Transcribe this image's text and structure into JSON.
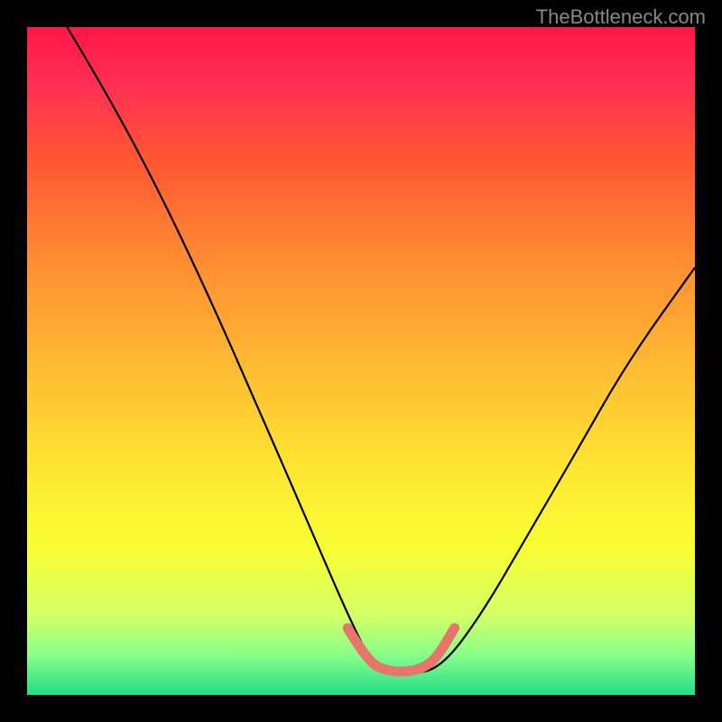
{
  "watermark": "TheBottleneck.com",
  "chart_data": {
    "type": "line",
    "title": "",
    "xlabel": "",
    "ylabel": "",
    "x_range": [
      0,
      100
    ],
    "y_range": [
      0,
      100
    ],
    "gradient_background": {
      "top_color": "#ff1744",
      "bottom_color": "#22dd88",
      "description": "red-to-green vertical gradient (bottleneck severity scale)"
    },
    "series": [
      {
        "name": "bottleneck-curve",
        "description": "V-shaped curve; left branch descends from top-left to a flat trough near x≈52-62 at y≈3, right branch ascends to upper-right",
        "points": [
          {
            "x": 6,
            "y": 100
          },
          {
            "x": 12,
            "y": 90
          },
          {
            "x": 20,
            "y": 75
          },
          {
            "x": 28,
            "y": 58
          },
          {
            "x": 35,
            "y": 42
          },
          {
            "x": 42,
            "y": 26
          },
          {
            "x": 48,
            "y": 12
          },
          {
            "x": 52,
            "y": 4
          },
          {
            "x": 57,
            "y": 3
          },
          {
            "x": 62,
            "y": 4
          },
          {
            "x": 68,
            "y": 12
          },
          {
            "x": 75,
            "y": 24
          },
          {
            "x": 82,
            "y": 36
          },
          {
            "x": 90,
            "y": 50
          },
          {
            "x": 100,
            "y": 64
          }
        ]
      },
      {
        "name": "trough-highlight",
        "description": "thick coral/red segment marking the optimal flat region at bottom of V",
        "color": "#e8756b",
        "points": [
          {
            "x": 48,
            "y": 10
          },
          {
            "x": 51,
            "y": 5
          },
          {
            "x": 54,
            "y": 3.5
          },
          {
            "x": 58,
            "y": 3.5
          },
          {
            "x": 61,
            "y": 5
          },
          {
            "x": 64,
            "y": 10
          }
        ]
      }
    ]
  }
}
